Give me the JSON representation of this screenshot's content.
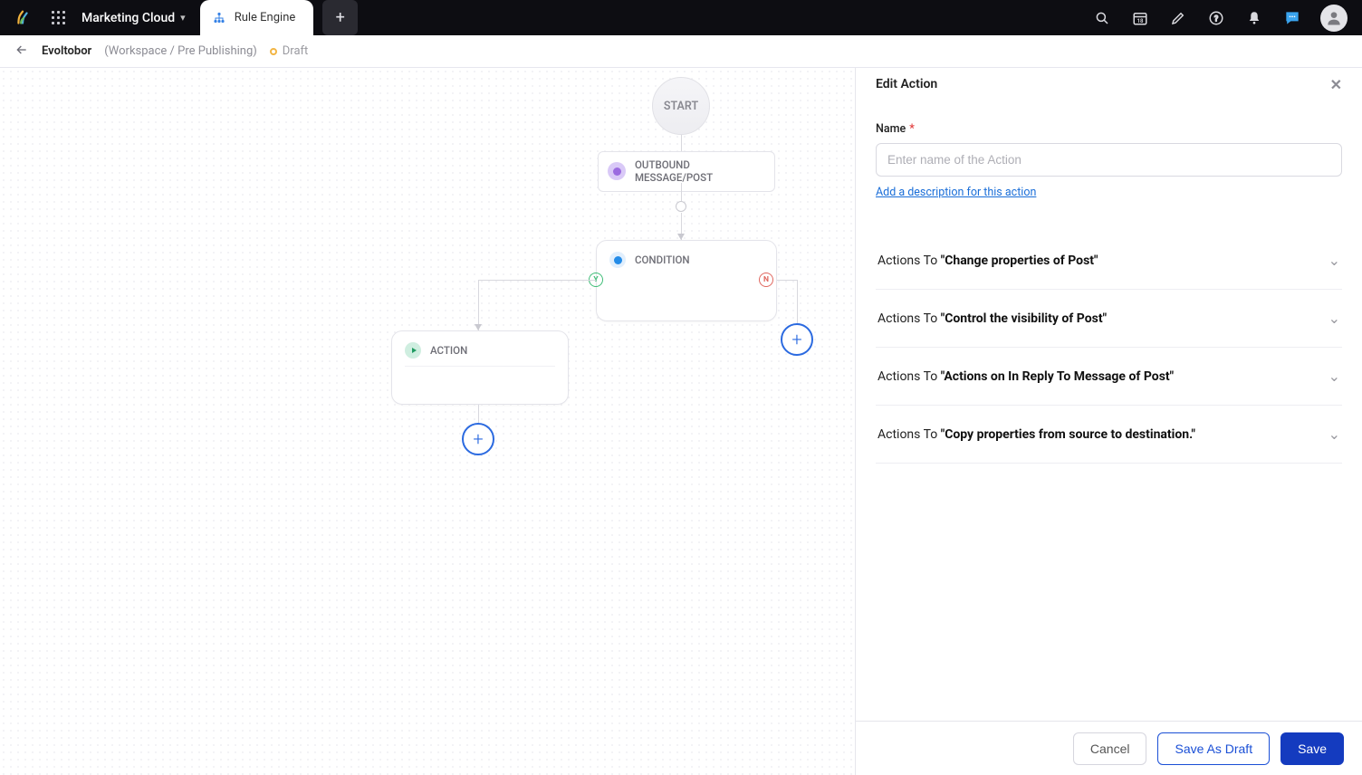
{
  "topbar": {
    "module_label": "Marketing Cloud",
    "active_tab_label": "Rule Engine"
  },
  "subheader": {
    "back_icon": "arrow-left",
    "workflow_name": "Evoltobor",
    "breadcrumb": "(Workspace / Pre Publishing)",
    "status_label": "Draft"
  },
  "canvas": {
    "start_label": "START",
    "event_label": "OUTBOUND MESSAGE/POST",
    "condition_label": "CONDITION",
    "action_label": "ACTION",
    "route_yes": "Y",
    "route_no": "N"
  },
  "panel": {
    "title": "Edit Action",
    "name_label": "Name",
    "name_placeholder": "Enter name of the Action",
    "add_description_link": "Add a description for this action",
    "accordion_prefix": "Actions To ",
    "accordion_items": [
      "\"Change properties of Post\"",
      "\"Control the visibility of Post\"",
      "\"Actions on In Reply To Message of Post\"",
      "\"Copy properties from source to destination.\""
    ],
    "buttons": {
      "cancel": "Cancel",
      "save_draft": "Save As Draft",
      "save": "Save"
    }
  }
}
